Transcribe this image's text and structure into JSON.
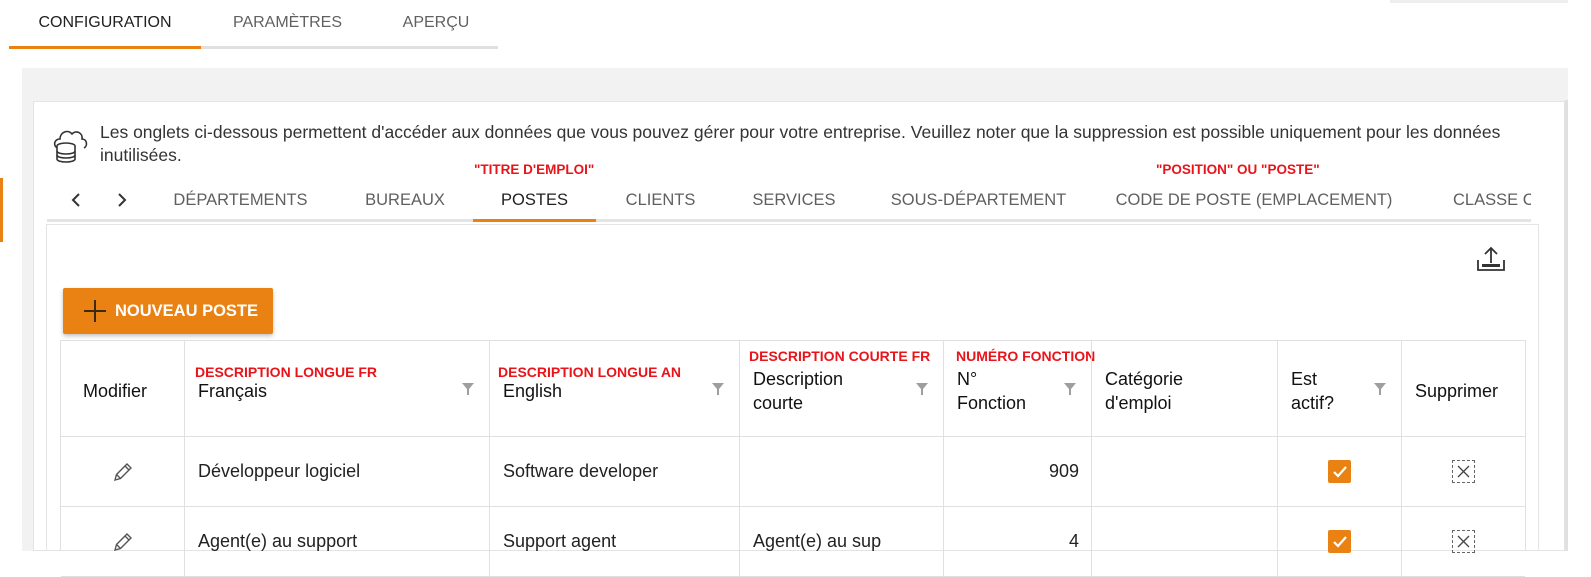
{
  "top_tabs": [
    {
      "label": "CONFIGURATION",
      "active": true
    },
    {
      "label": "PARAMÈTRES",
      "active": false
    },
    {
      "label": "APERÇU",
      "active": false
    }
  ],
  "info": {
    "icon": "cloud-database-icon",
    "text": "Les onglets ci-dessous permettent d'accéder aux données que vous pouvez gérer pour votre entreprise. Veuillez noter que la suppression est possible uniquement pour les données inutilisées."
  },
  "annotations": {
    "postes": "\"TITRE D'EMPLOI\"",
    "code_poste": "\"POSITION\" OU \"POSTE\"",
    "francais": "DESCRIPTION LONGUE FR",
    "english": "DESCRIPTION LONGUE AN",
    "desc_courte": "DESCRIPTION COURTE FR",
    "no_fonction": "NUMÉRO FONCTION"
  },
  "sub_tabs": [
    {
      "label": "DÉPARTEMENTS",
      "active": false
    },
    {
      "label": "BUREAUX",
      "active": false
    },
    {
      "label": "POSTES",
      "active": true
    },
    {
      "label": "CLIENTS",
      "active": false
    },
    {
      "label": "SERVICES",
      "active": false
    },
    {
      "label": "SOUS-DÉPARTEMENT",
      "active": false
    },
    {
      "label": "CODE DE POSTE (EMPLACEMENT)",
      "active": false
    },
    {
      "label": "CLASSE C",
      "active": false
    }
  ],
  "new_button": {
    "label": "NOUVEAU POSTE",
    "icon": "plus-icon"
  },
  "export": {
    "icon": "export-icon"
  },
  "grid": {
    "columns": [
      {
        "key": "modifier",
        "label": "Modifier"
      },
      {
        "key": "francais",
        "label": "Français"
      },
      {
        "key": "english",
        "label": "English"
      },
      {
        "key": "desc_courte",
        "label": "Description courte"
      },
      {
        "key": "no_fonction",
        "label": "N° Fonction"
      },
      {
        "key": "categorie",
        "label": "Catégorie d'emploi"
      },
      {
        "key": "actif",
        "label": "Est actif?"
      },
      {
        "key": "supprimer",
        "label": "Supprimer"
      }
    ],
    "rows": [
      {
        "francais": "Développeur logiciel",
        "english": "Software developer",
        "desc_courte": "",
        "no_fonction": "909",
        "categorie": "",
        "actif": true
      },
      {
        "francais": "Agent(e) au support",
        "english": "Support agent",
        "desc_courte": "Agent(e) au sup",
        "no_fonction": "4",
        "categorie": "",
        "actif": true
      }
    ]
  },
  "colors": {
    "accent": "#e98213",
    "annotation": "#e8141a"
  }
}
